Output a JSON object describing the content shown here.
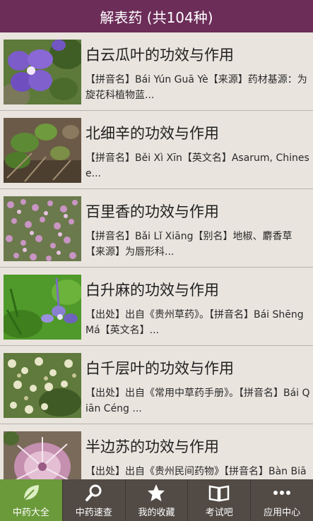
{
  "header": {
    "title": "解表药 (共104种)"
  },
  "items": [
    {
      "title": "白云瓜叶的功效与作用",
      "desc": "【拼音名】Bái Yún Guā Yè【来源】药材基源：为旋花科植物蓝..."
    },
    {
      "title": "北细辛的功效与作用",
      "desc": "【拼音名】Běi Xì Xīn【英文名】Asarum, Chinese..."
    },
    {
      "title": "百里香的功效与作用",
      "desc": "【拼音名】Bǎi Lǐ Xiāng【别名】地椒、麝香草【来源】为唇形科..."
    },
    {
      "title": "白升麻的功效与作用",
      "desc": "【出处】出自《贵州草药》。【拼音名】Bái Shēng Má【英文名】..."
    },
    {
      "title": "白千层叶的功效与作用",
      "desc": "【出处】出自《常用中草药手册》。【拼音名】Bái Qiān Céng ..."
    },
    {
      "title": "半边苏的功效与作用",
      "desc": "【出处】出自《贵州民间药物》【拼音名】Bàn Biān Sū【英文名】..."
    }
  ],
  "tabs": [
    {
      "label": "中药大全",
      "icon": "leaf-icon",
      "active": true
    },
    {
      "label": "中药速查",
      "icon": "search-icon",
      "active": false
    },
    {
      "label": "我的收藏",
      "icon": "star-icon",
      "active": false
    },
    {
      "label": "考试吧",
      "icon": "book-icon",
      "active": false
    },
    {
      "label": "应用中心",
      "icon": "more-icon",
      "active": false
    }
  ],
  "colors": {
    "header": "#6c2d59",
    "tabbar": "#514a45",
    "active_tab": "#6b9a3a",
    "background": "#e5e0da"
  }
}
